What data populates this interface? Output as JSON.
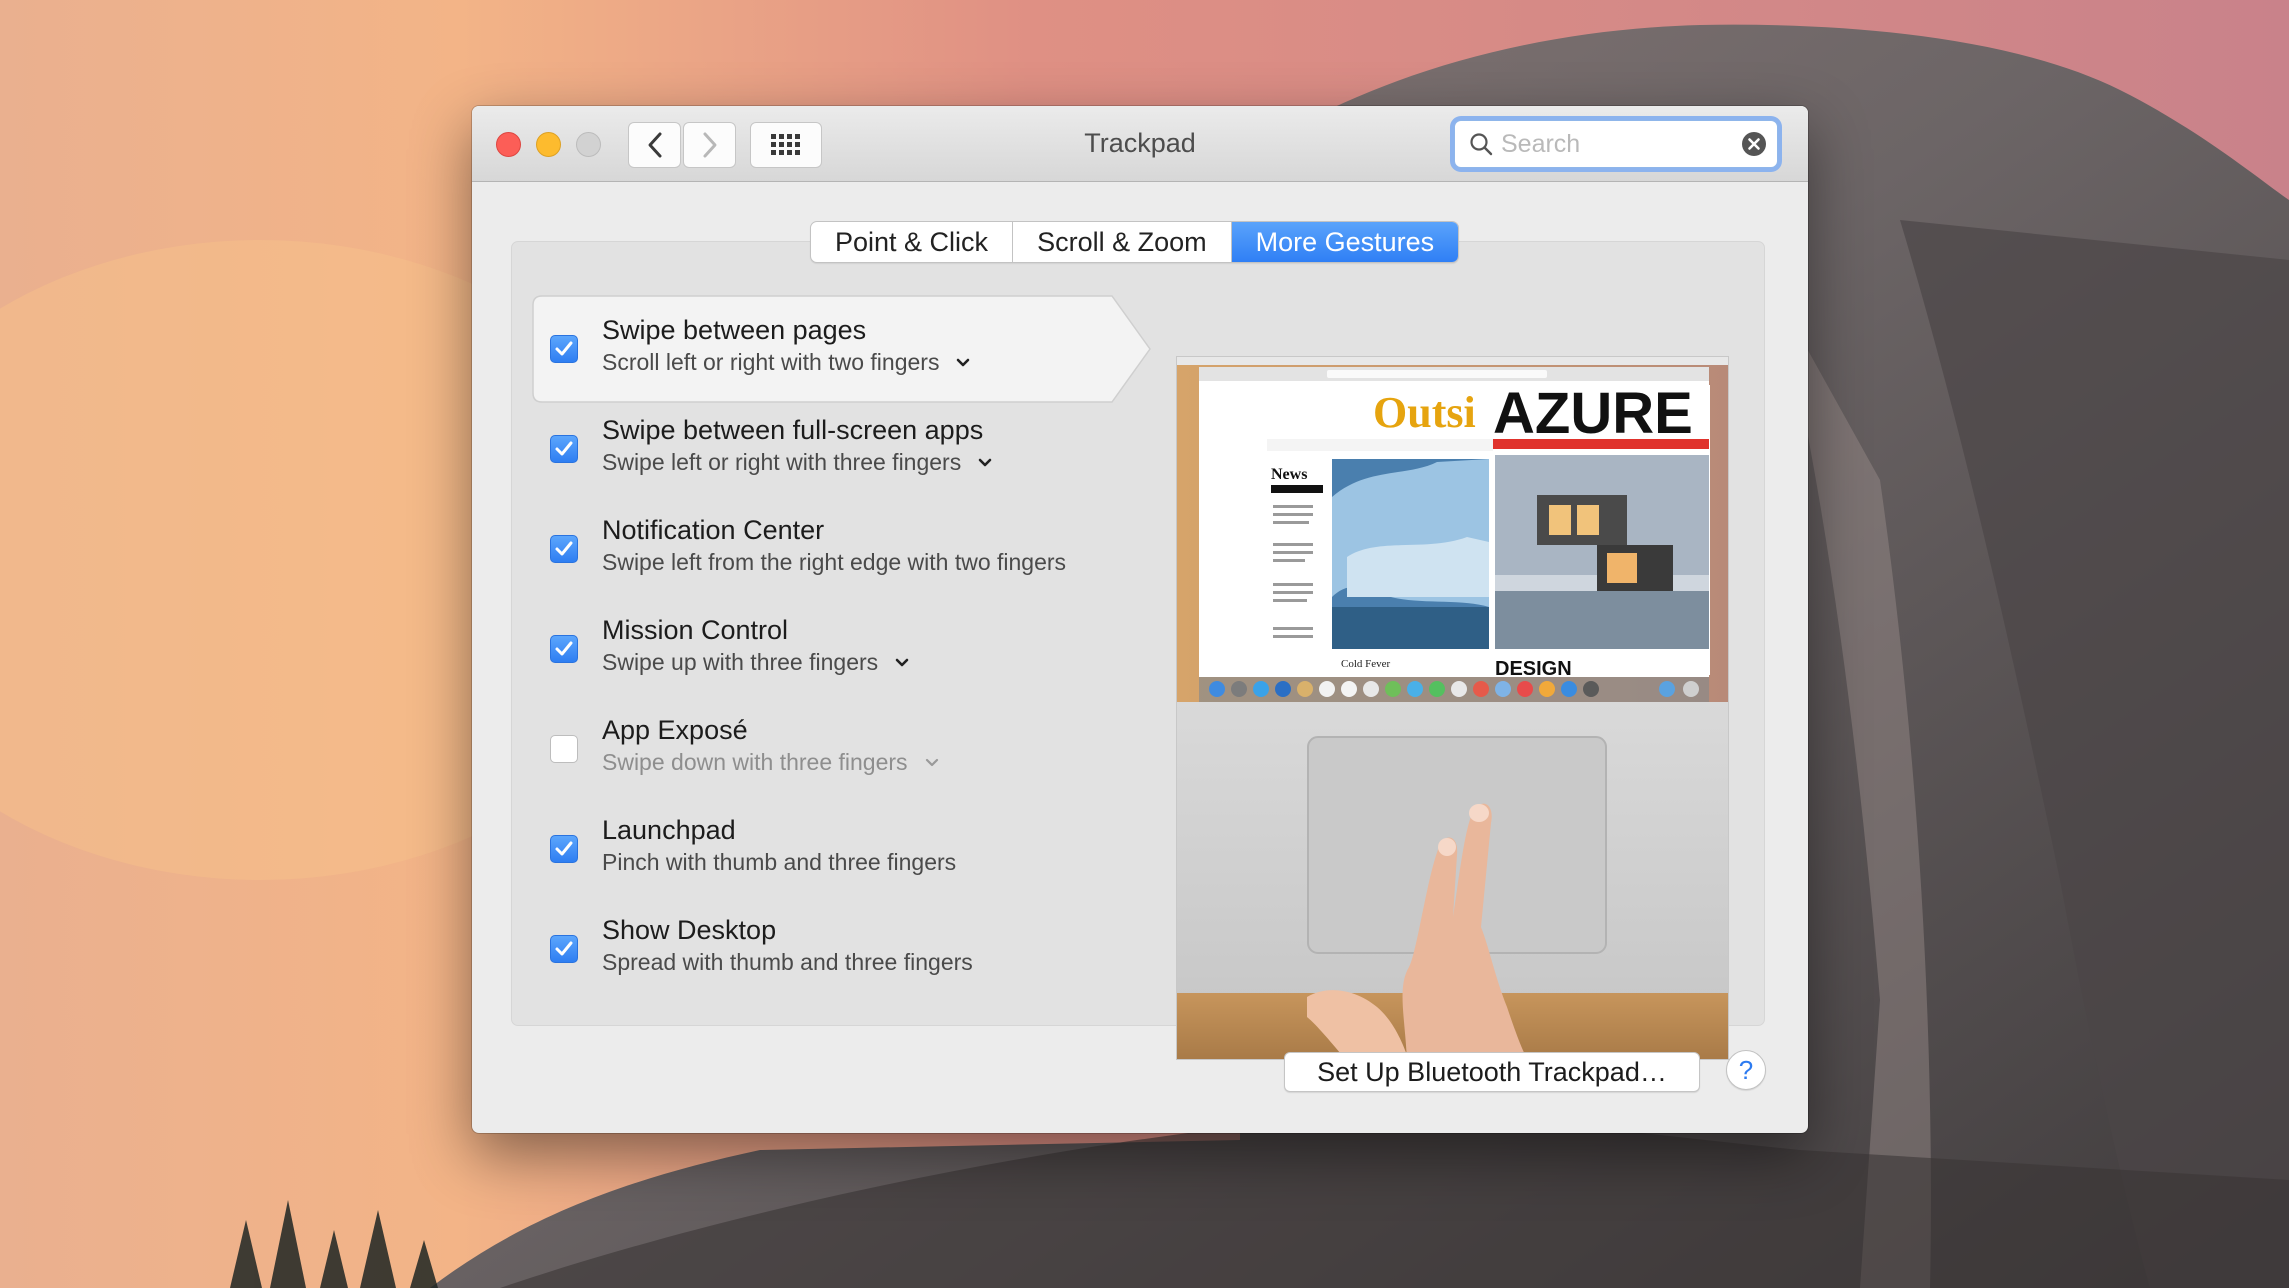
{
  "window": {
    "title": "Trackpad",
    "search_placeholder": "Search"
  },
  "tabs": [
    {
      "label": "Point & Click",
      "active": false
    },
    {
      "label": "Scroll & Zoom",
      "active": false
    },
    {
      "label": "More Gestures",
      "active": true
    }
  ],
  "gestures": [
    {
      "title": "Swipe between pages",
      "subtitle": "Scroll left or right with two fingers",
      "checked": true,
      "has_menu": true,
      "selected": true
    },
    {
      "title": "Swipe between full-screen apps",
      "subtitle": "Swipe left or right with three fingers",
      "checked": true,
      "has_menu": true,
      "selected": false
    },
    {
      "title": "Notification Center",
      "subtitle": "Swipe left from the right edge with two fingers",
      "checked": true,
      "has_menu": false,
      "selected": false
    },
    {
      "title": "Mission Control",
      "subtitle": "Swipe up with three fingers",
      "checked": true,
      "has_menu": true,
      "selected": false
    },
    {
      "title": "App Exposé",
      "subtitle": "Swipe down with three fingers",
      "checked": false,
      "has_menu": true,
      "selected": false
    },
    {
      "title": "Launchpad",
      "subtitle": "Pinch with thumb and three fingers",
      "checked": true,
      "has_menu": false,
      "selected": false
    },
    {
      "title": "Show Desktop",
      "subtitle": "Spread with thumb and three fingers",
      "checked": true,
      "has_menu": false,
      "selected": false
    }
  ],
  "preview": {
    "browser_brand": "Outsi",
    "headline": "AZURE",
    "section": "News",
    "caption": "Cold Fever",
    "footer_word": "DESIGN"
  },
  "footer": {
    "setup_label": "Set Up Bluetooth Trackpad…",
    "help_label": "?"
  },
  "colors": {
    "accent": "#2f7ff5",
    "close": "#fc5e57",
    "minimize": "#fdbb2e"
  }
}
